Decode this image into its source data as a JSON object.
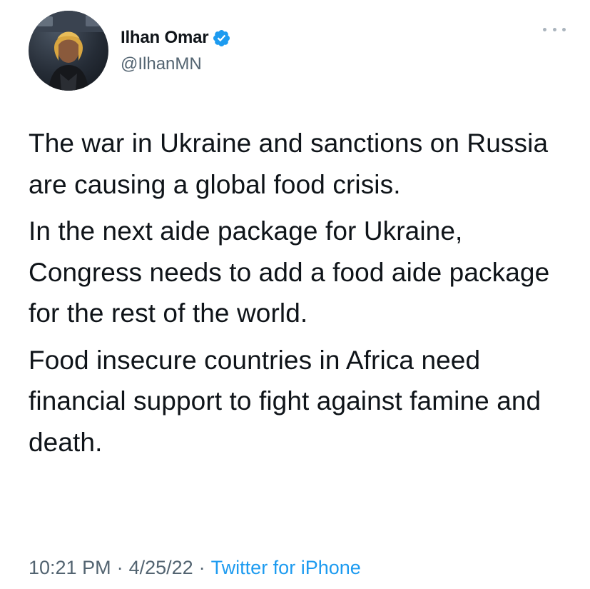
{
  "author": {
    "name": "Ilhan Omar",
    "handle": "@IlhanMN",
    "verified": true
  },
  "tweet": {
    "paragraphs": [
      "The war in Ukraine and sanctions on Russia are causing a global food crisis.",
      "In the next aide package for Ukraine, Congress needs to add a food aide package for the rest of the world.",
      "Food insecure countries in Africa need financial support to fight against famine and death."
    ],
    "time": "10:21 PM",
    "date": "4/25/22",
    "separator": "·",
    "source": "Twitter for iPhone"
  },
  "icons": {
    "verified": "verified-badge-icon",
    "more": "more-options-icon"
  },
  "colors": {
    "accent": "#1d9bf0",
    "text": "#0f1419",
    "muted": "#536471"
  }
}
